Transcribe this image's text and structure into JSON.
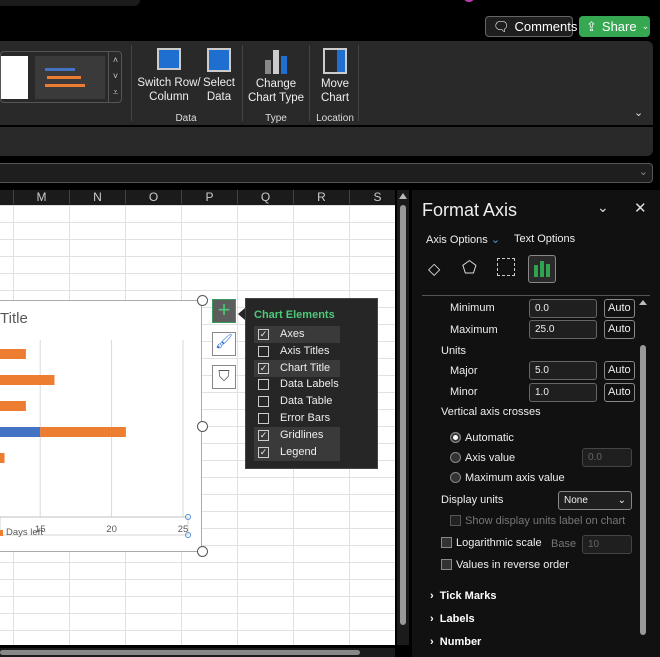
{
  "topbar": {
    "comments": "Comments",
    "share": "Share"
  },
  "ribbon": {
    "buttons": [
      {
        "label1": "Switch Row/",
        "label2": "Column"
      },
      {
        "label1": "Select",
        "label2": "Data"
      },
      {
        "label1": "Change",
        "label2": "Chart Type"
      },
      {
        "label1": "Move",
        "label2": "Chart"
      }
    ],
    "groups": [
      "Data",
      "Type",
      "Location"
    ]
  },
  "columns": [
    "M",
    "N",
    "O",
    "P",
    "Q",
    "R",
    "S"
  ],
  "chart": {
    "title": "Title",
    "legend": "Days left",
    "colors": {
      "series1": "#4472c4",
      "series2": "#ed7d31"
    }
  },
  "chart_data": {
    "type": "bar",
    "orientation": "horizontal",
    "stacked": true,
    "xticks": [
      "15",
      "20",
      "25"
    ],
    "xlim": [
      0,
      25
    ],
    "legend": [
      "Days left"
    ],
    "grid": true
  },
  "chart_elements": {
    "title": "Chart Elements",
    "items": [
      {
        "label": "Axes",
        "checked": true
      },
      {
        "label": "Axis Titles",
        "checked": false
      },
      {
        "label": "Chart Title",
        "checked": true
      },
      {
        "label": "Data Labels",
        "checked": false
      },
      {
        "label": "Data Table",
        "checked": false
      },
      {
        "label": "Error Bars",
        "checked": false
      },
      {
        "label": "Gridlines",
        "checked": true
      },
      {
        "label": "Legend",
        "checked": true
      }
    ]
  },
  "pane": {
    "title": "Format Axis",
    "tab_axis": "Axis Options",
    "tab_text": "Text Options",
    "minimum_label": "Minimum",
    "minimum": "0.0",
    "maximum_label": "Maximum",
    "maximum": "25.0",
    "units": "Units",
    "major_label": "Major",
    "major": "5.0",
    "minor_label": "Minor",
    "minor": "1.0",
    "auto": "Auto",
    "crosses": "Vertical axis crosses",
    "automatic": "Automatic",
    "axis_value": "Axis value",
    "axis_value_input": "0.0",
    "max_axis": "Maximum axis value",
    "display_units": "Display units",
    "display_units_value": "None",
    "show_units": "Show display units label on chart",
    "log": "Logarithmic scale",
    "base": "Base",
    "base_value": "10",
    "reverse": "Values in reverse order",
    "sections": [
      "Tick Marks",
      "Labels",
      "Number"
    ]
  }
}
